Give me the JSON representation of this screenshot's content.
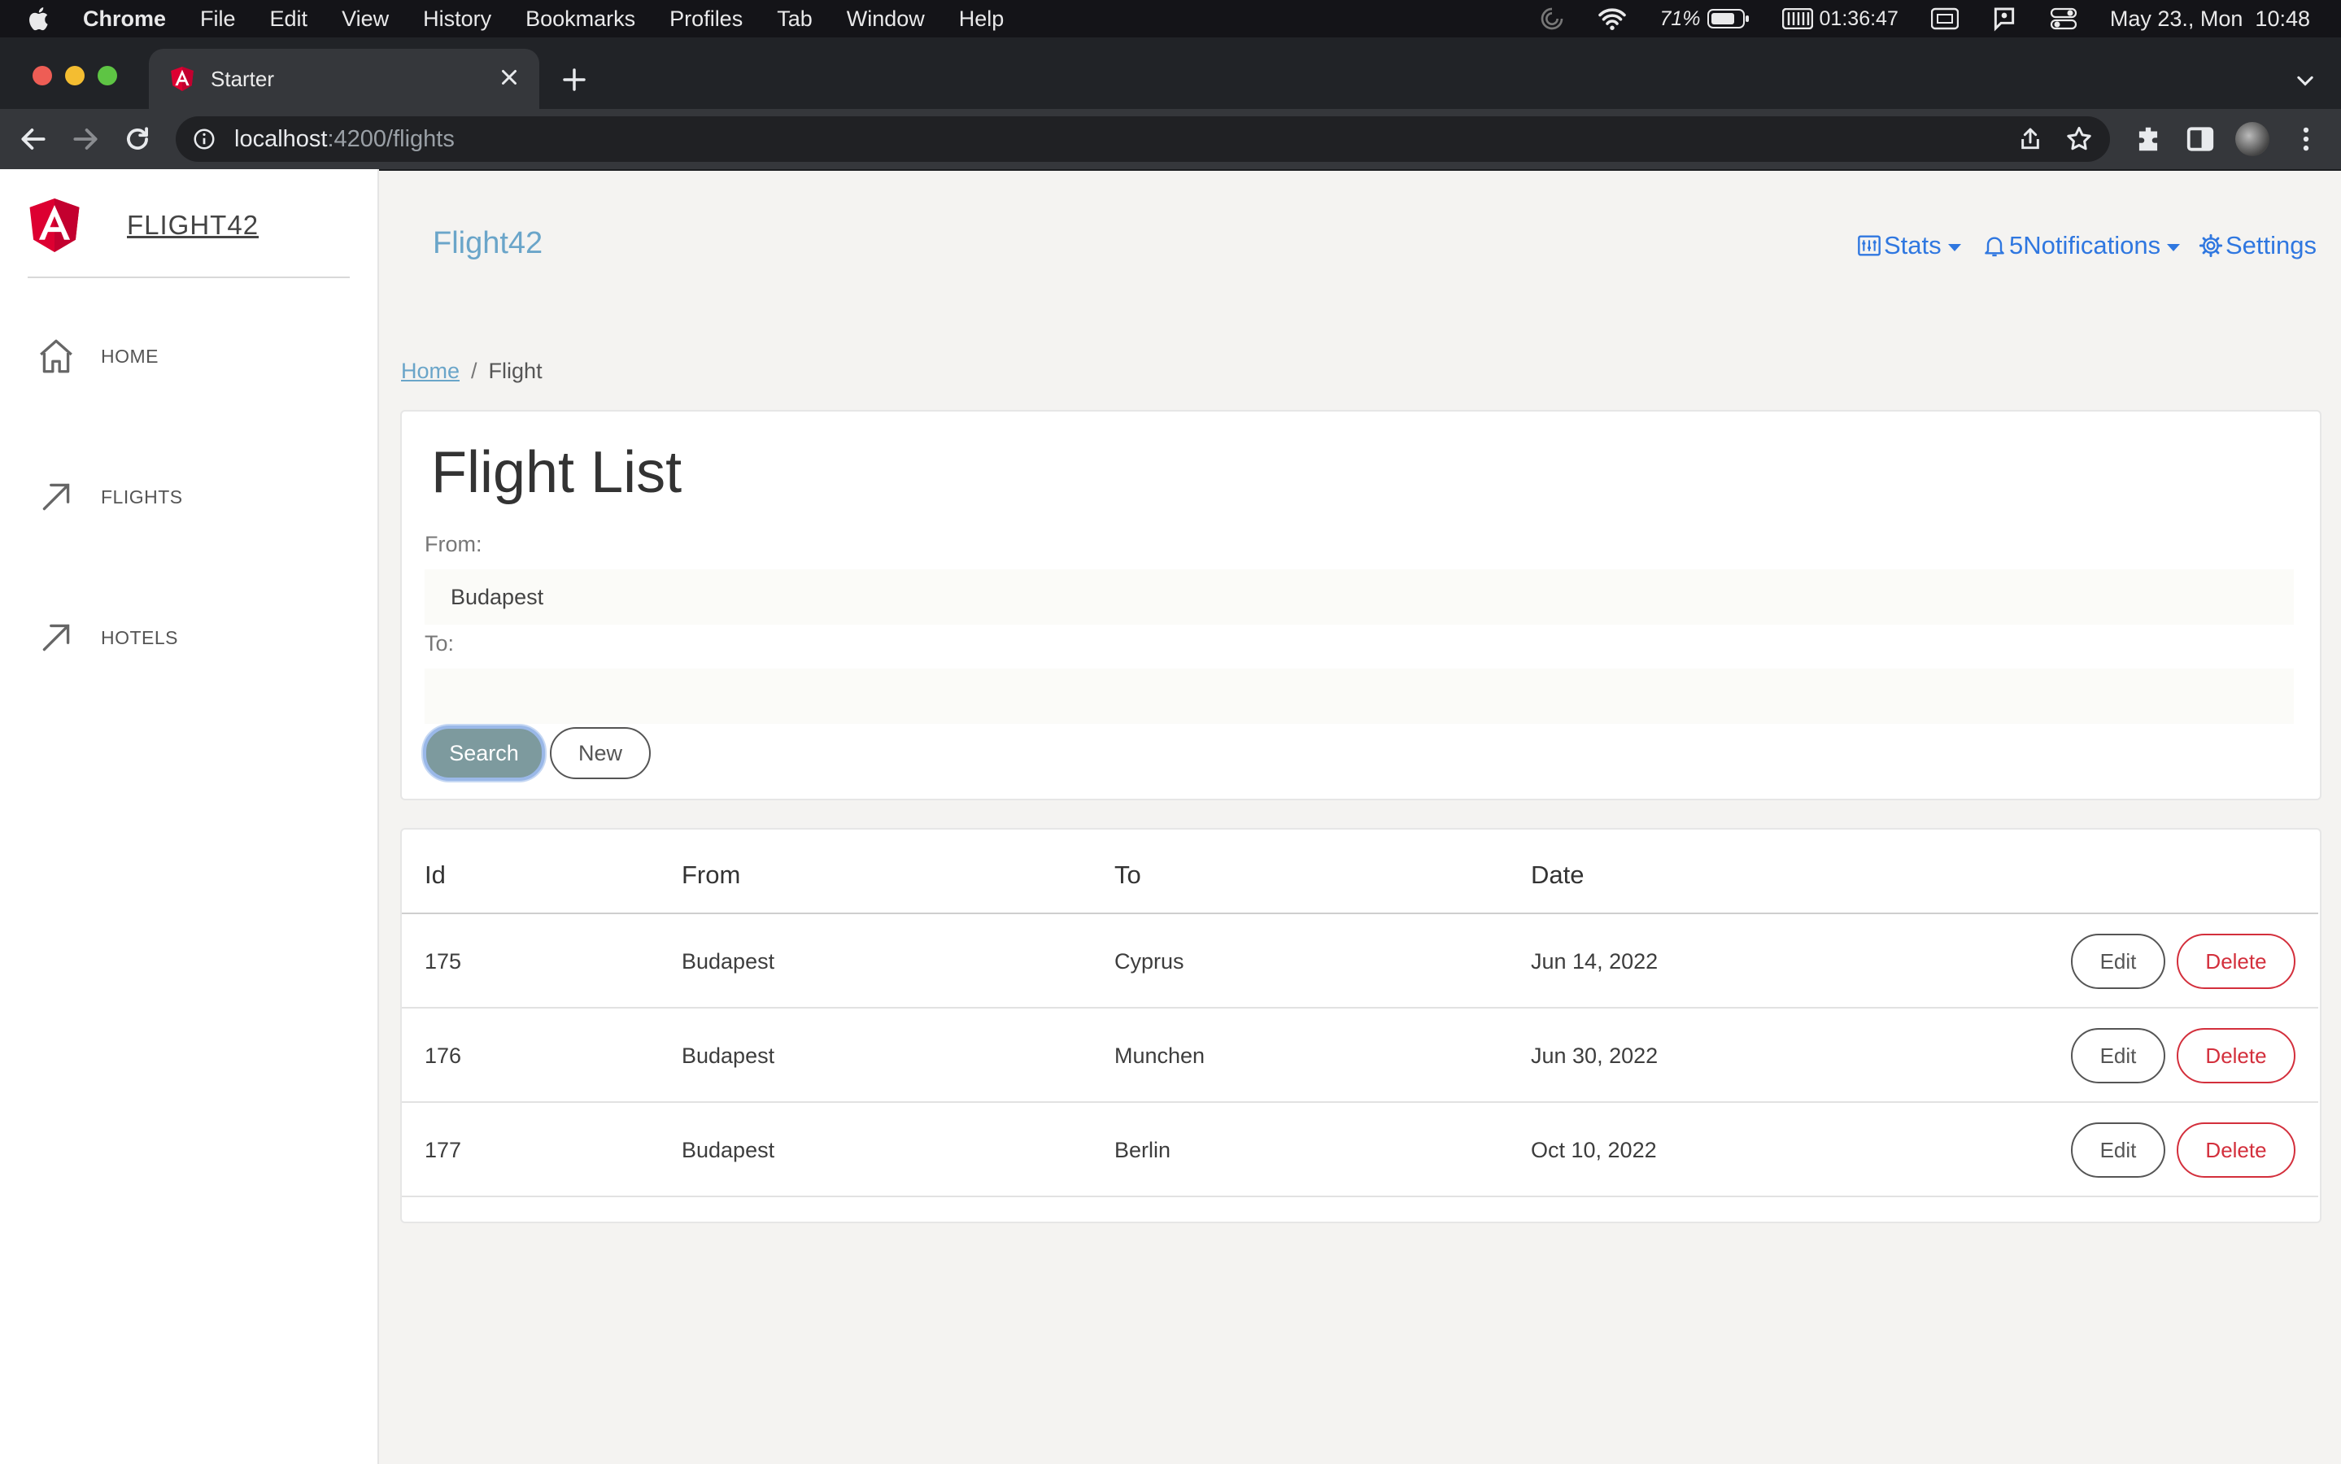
{
  "menubar": {
    "items": [
      "Chrome",
      "File",
      "Edit",
      "View",
      "History",
      "Bookmarks",
      "Profiles",
      "Tab",
      "Window",
      "Help"
    ],
    "battery": "71%",
    "timer": "01:36:47",
    "datetime": "May 23., Mon  10:48"
  },
  "browser": {
    "tab_title": "Starter",
    "url_host": "localhost",
    "url_rest": ":4200/flights"
  },
  "sidebar": {
    "brand": "FLIGHT42",
    "items": [
      {
        "label": "HOME",
        "icon": "home-icon"
      },
      {
        "label": "FLIGHTS",
        "icon": "arrow-up-right-icon"
      },
      {
        "label": "HOTELS",
        "icon": "arrow-up-right-icon"
      }
    ]
  },
  "header": {
    "title": "Flight42",
    "stats": "Stats",
    "notifications_count": "5",
    "notifications": "Notifications",
    "settings": "Settings"
  },
  "breadcrumb": {
    "home": "Home",
    "separator": "/",
    "current": "Flight"
  },
  "search": {
    "heading": "Flight List",
    "from_label": "From:",
    "from_value": "Budapest",
    "to_label": "To:",
    "to_value": "",
    "search_button": "Search",
    "new_button": "New"
  },
  "table": {
    "columns": [
      "Id",
      "From",
      "To",
      "Date"
    ],
    "rows": [
      {
        "id": "175",
        "from": "Budapest",
        "to": "Cyprus",
        "date": "Jun 14, 2022"
      },
      {
        "id": "176",
        "from": "Budapest",
        "to": "Munchen",
        "date": "Jun 30, 2022"
      },
      {
        "id": "177",
        "from": "Budapest",
        "to": "Berlin",
        "date": "Oct 10, 2022"
      }
    ],
    "edit_label": "Edit",
    "delete_label": "Delete"
  },
  "colors": {
    "accent": "#2f77e0",
    "brand_title": "#6aa5c9",
    "danger": "#d32f3c",
    "search_button": "#7d9a9e"
  }
}
